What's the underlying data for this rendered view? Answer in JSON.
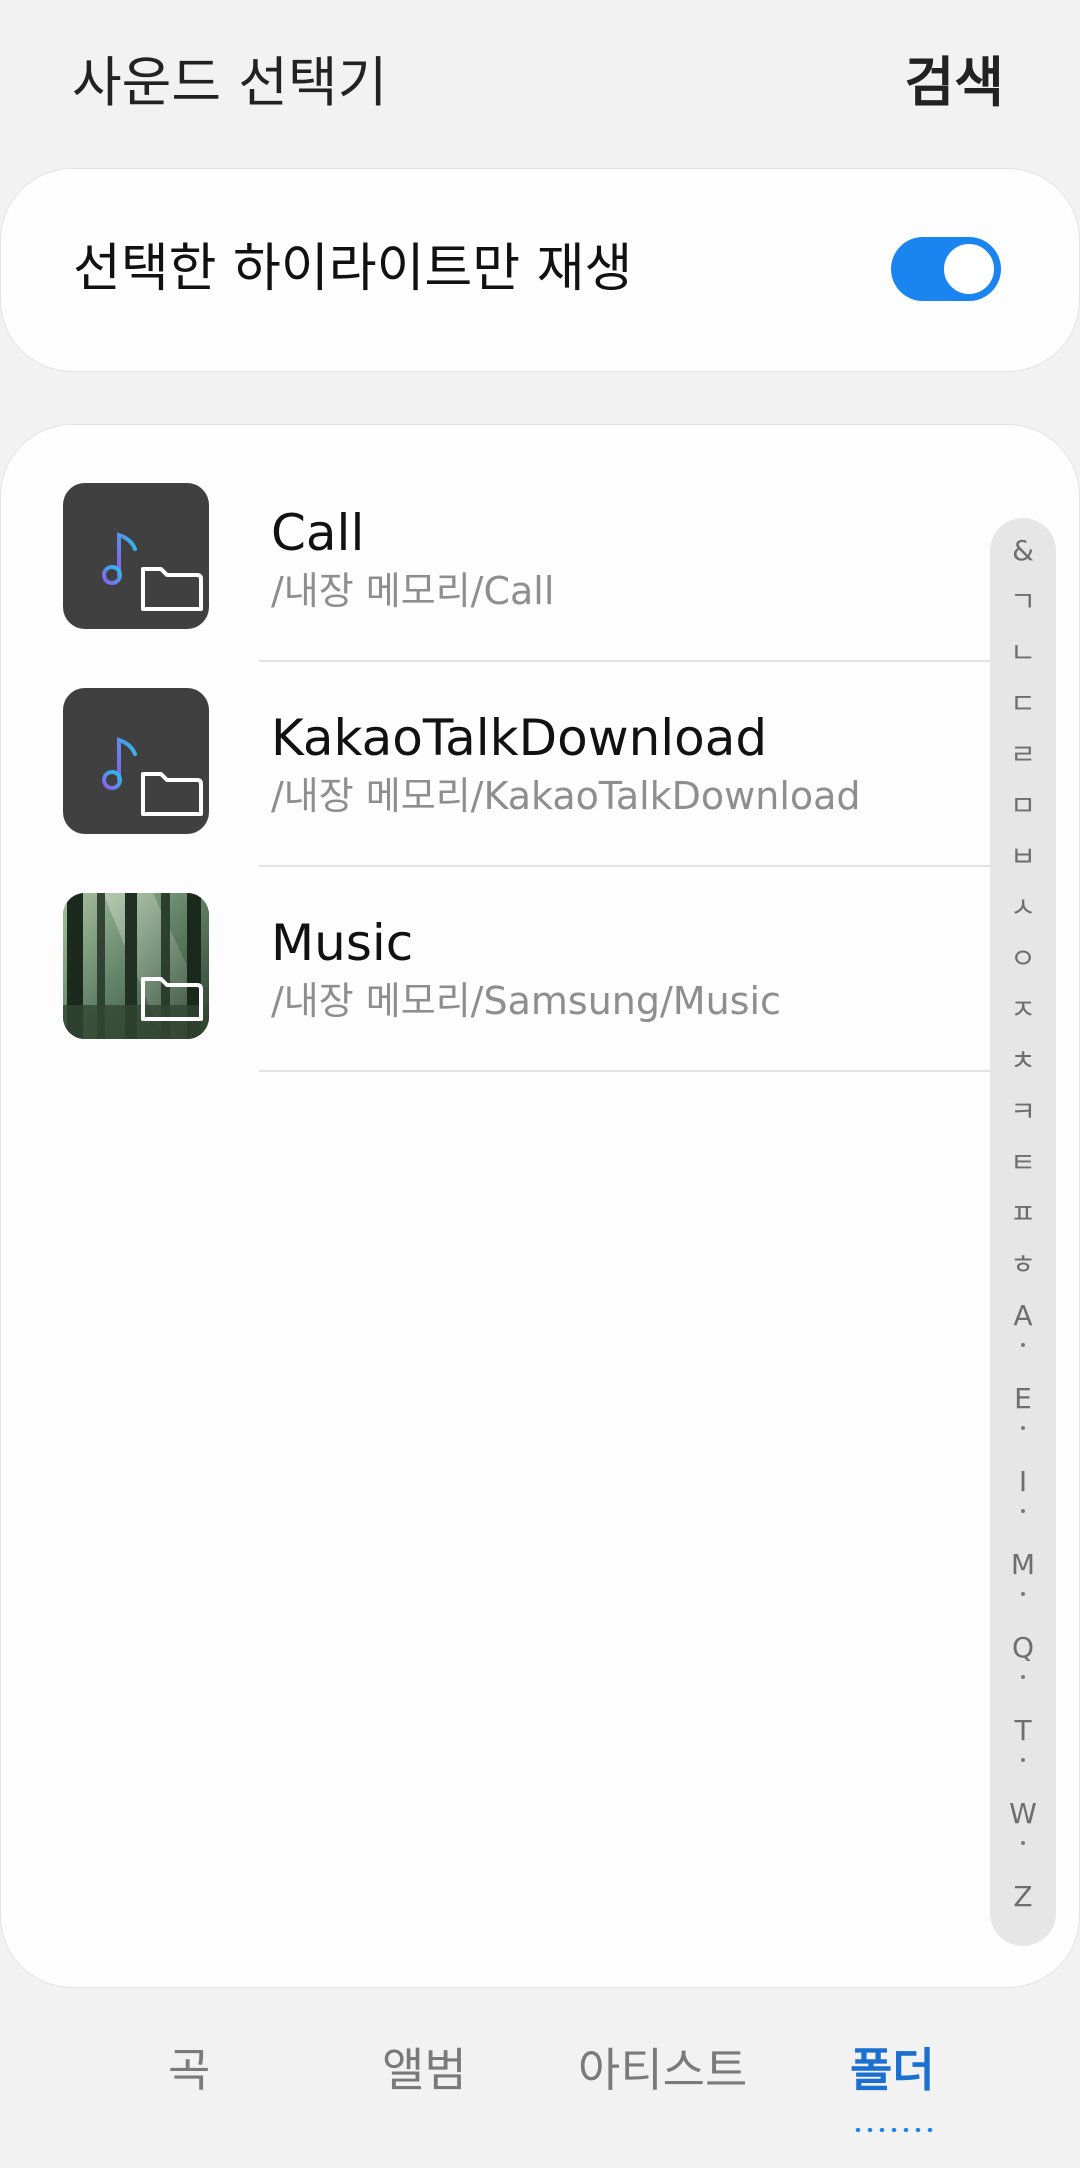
{
  "header": {
    "title": "사운드 선택기",
    "search_label": "검색"
  },
  "highlight_toggle": {
    "label": "선택한 하이라이트만 재생",
    "enabled": true
  },
  "folders": [
    {
      "name": "Call",
      "path": "/내장 메모리/Call",
      "thumbnail": "music-note-folder-icon"
    },
    {
      "name": "KakaoTalkDownload",
      "path": "/내장 메모리/KakaoTalkDownload",
      "thumbnail": "music-note-folder-icon"
    },
    {
      "name": "Music",
      "path": "/내장 메모리/Samsung/Music",
      "thumbnail": "album-art-forest-folder-icon"
    }
  ],
  "index_bar": [
    "&",
    "ㄱ",
    "ㄴ",
    "ㄷ",
    "ㄹ",
    "ㅁ",
    "ㅂ",
    "ㅅ",
    "ㅇ",
    "ㅈ",
    "ㅊ",
    "ㅋ",
    "ㅌ",
    "ㅍ",
    "ㅎ",
    "A",
    "E",
    "I",
    "M",
    "Q",
    "T",
    "W",
    "Z"
  ],
  "tabs": [
    {
      "label": "곡",
      "active": false
    },
    {
      "label": "앨범",
      "active": false
    },
    {
      "label": "아티스트",
      "active": false
    },
    {
      "label": "폴더",
      "active": true
    }
  ],
  "colors": {
    "accent": "#1a84f0",
    "active_tab": "#1a6fd0",
    "background": "#f2f2f2",
    "card": "#fdfdfd"
  }
}
